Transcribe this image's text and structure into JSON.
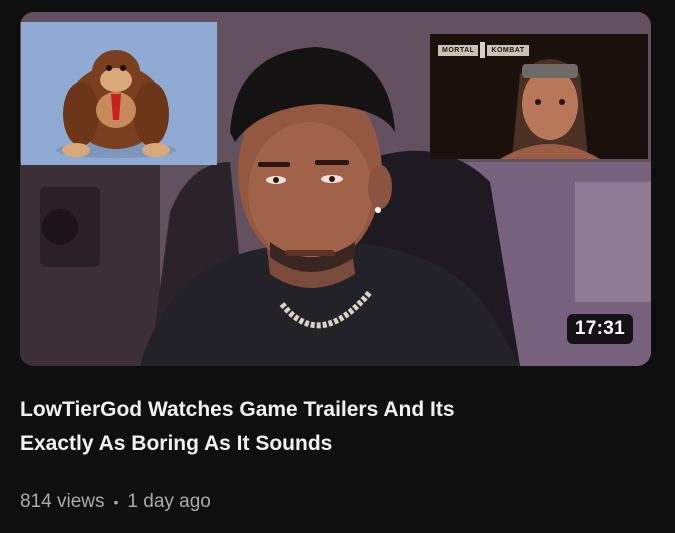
{
  "video": {
    "title_line1": "LowTierGod Watches Game Trailers And Its",
    "title_line2": "Exactly As Boring As It Sounds",
    "duration": "17:31",
    "views": "814 views",
    "separator": "•",
    "age": "1 day ago"
  },
  "thumbnail": {
    "inset_right_logo_left": "MORTAL",
    "inset_right_logo_right": "KOMBAT"
  },
  "colors": {
    "background": "#0f0f0f",
    "title": "#f1f1f1",
    "meta": "#aaaaaa",
    "duration_bg": "#000000"
  }
}
